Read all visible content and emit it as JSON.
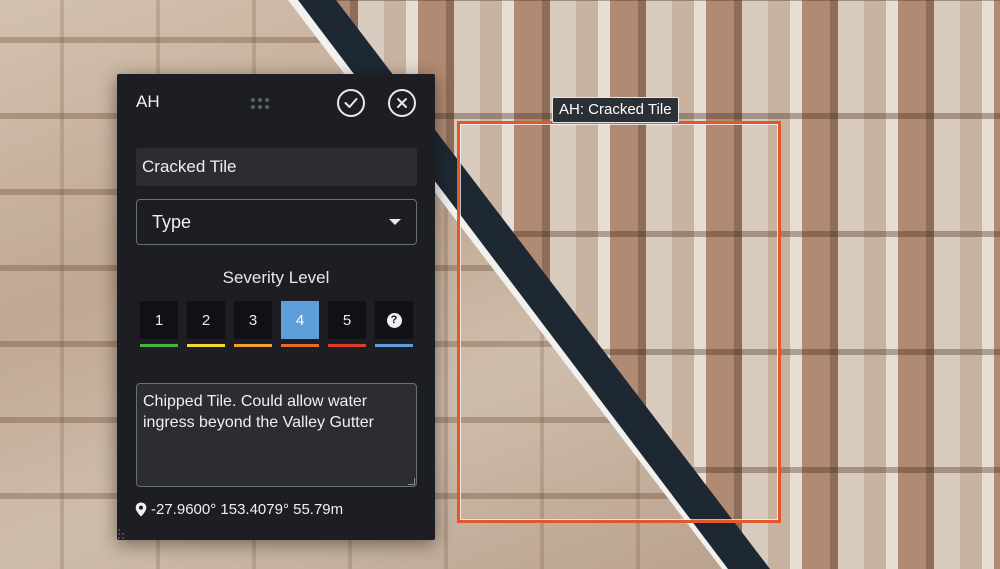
{
  "annotation": {
    "label": "AH: Cracked Tile",
    "box_color": "#e2582a"
  },
  "panel": {
    "title": "AH",
    "icons": {
      "drag": "drag-handle-icon",
      "confirm": "check-circle-icon",
      "close": "close-circle-icon"
    },
    "name_value": "Cracked Tile",
    "type_select": {
      "label": "Type"
    },
    "severity": {
      "title": "Severity Level",
      "selected": "4",
      "levels": [
        {
          "label": "1",
          "color": "#4caf3f"
        },
        {
          "label": "2",
          "color": "#f4d836"
        },
        {
          "label": "3",
          "color": "#f0a033"
        },
        {
          "label": "4",
          "color": "#e46a2a"
        },
        {
          "label": "5",
          "color": "#df3b26"
        },
        {
          "label": "?",
          "color": "#5e9edb"
        }
      ]
    },
    "notes": "Chipped Tile. Could allow water ingress beyond the Valley Gutter",
    "location": "-27.9600° 153.4079° 55.79m"
  }
}
